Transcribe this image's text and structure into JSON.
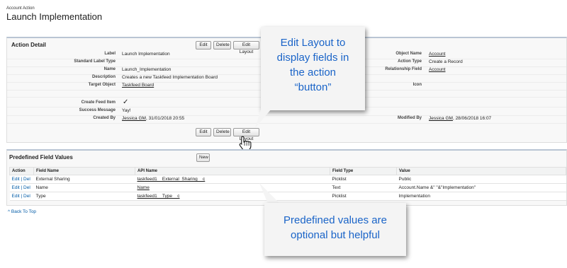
{
  "header": {
    "subtitle": "Account Action",
    "title": "Launch Implementation"
  },
  "detail": {
    "title": "Action Detail",
    "buttons": {
      "edit": "Edit",
      "delete": "Delete",
      "edit_layout": "Edit Layout"
    },
    "left_fields": [
      {
        "label": "Label",
        "value": "Launch Implementation"
      },
      {
        "label": "Standard Label Type",
        "value": ""
      },
      {
        "label": "Name",
        "value": "Launch_Implementation"
      },
      {
        "label": "Description",
        "value": "Creates a new Taskfeed Implementation Board"
      },
      {
        "label": "Target Object",
        "value": "Taskfeed Board"
      },
      {
        "label": "Create Feed Item",
        "value": "✓"
      },
      {
        "label": "Success Message",
        "value": "Yay!"
      },
      {
        "label": "Created By",
        "value": "Jessica GM",
        "value_suffix": ", 31/01/2018 20:55"
      }
    ],
    "right_fields": [
      {
        "label": "Object Name",
        "value": "Account"
      },
      {
        "label": "Action Type",
        "value": "Create a Record"
      },
      {
        "label": "Relationship Field",
        "value": "Account"
      },
      {
        "label": "Icon",
        "value": ""
      },
      {
        "label": "Modified By",
        "value": "Jessica GM",
        "value_suffix": ", 28/06/2018 16:07"
      }
    ]
  },
  "pfv": {
    "title": "Predefined Field Values",
    "new_button": "New",
    "columns": [
      "Action",
      "Field Name",
      "API Name",
      "Field Type",
      "Value"
    ],
    "rows": [
      {
        "edit": "Edit",
        "sep": " | ",
        "del": "Del",
        "field": "External Sharing",
        "api": "taskfeed1__External_Sharing__c",
        "type": "Picklist",
        "value": "Public"
      },
      {
        "edit": "Edit",
        "sep": " | ",
        "del": "Del",
        "field": "Name",
        "api": "Name",
        "type": "Text",
        "value": "Account.Name &\" \"&\"Implementation\""
      },
      {
        "edit": "Edit",
        "sep": " | ",
        "del": "Del",
        "field": "Type",
        "api": "taskfeed1__Type__c",
        "type": "Picklist",
        "value": "Implementation"
      }
    ]
  },
  "back_to_top": "Back To Top",
  "callouts": {
    "one": [
      "Edit Layout to",
      "display fields in",
      "the action",
      "“button”"
    ],
    "two": [
      "Predefined values are",
      "optional but helpful"
    ]
  },
  "colors": {
    "callout_text": "#1a64c8",
    "link_blue": "#015ba7",
    "section_border": "#b9c5d4"
  },
  "icons": {
    "cursor": "hand-pointer-icon",
    "up": "caret-up-icon"
  }
}
